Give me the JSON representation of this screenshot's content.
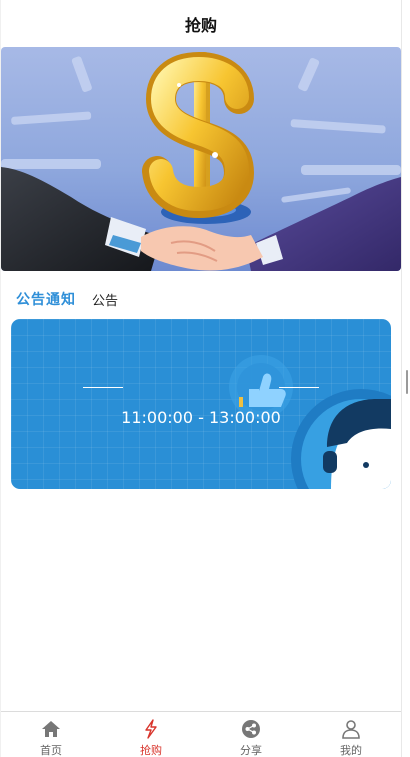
{
  "header": {
    "title": "抢购"
  },
  "notice": {
    "tag": "公告通知",
    "text": "公告"
  },
  "session": {
    "title": "",
    "time": "11:00:00 - 13:00:00"
  },
  "tabbar": {
    "items": [
      {
        "label": "首页",
        "icon": "home-icon",
        "active": false
      },
      {
        "label": "抢购",
        "icon": "flash-sale-icon",
        "active": true
      },
      {
        "label": "分享",
        "icon": "share-icon",
        "active": false
      },
      {
        "label": "我的",
        "icon": "user-icon",
        "active": false
      }
    ]
  },
  "colors": {
    "accent": "#2f8fd8",
    "active_tab": "#d8342b",
    "card_bg": "#2a8fd6"
  }
}
